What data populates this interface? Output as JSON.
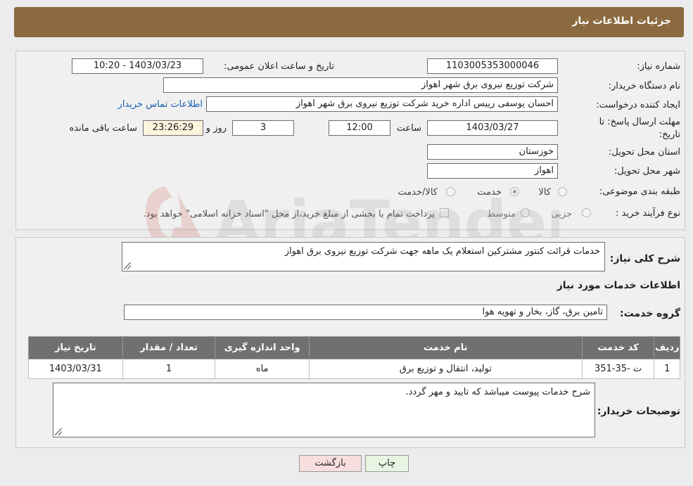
{
  "header": {
    "title": "جزئیات اطلاعات نیاز"
  },
  "form": {
    "need_number_label": "شماره نیاز:",
    "need_number": "1103005353000046",
    "announce_label": "تاریخ و ساعت اعلان عمومی:",
    "announce_value": "1403/03/23 - 10:20",
    "buyer_org_label": "نام دستگاه خریدار:",
    "buyer_org": "شرکت توزیع نیروی برق شهر اهواز",
    "creator_label": "ایجاد کننده درخواست:",
    "creator": "احسان یوسفی رییس اداره خرید شرکت توزیع نیروی برق شهر اهواز",
    "contact_link": "اطلاعات تماس خریدار",
    "deadline_label_1": "مهلت ارسال پاسخ: تا",
    "deadline_label_2": "تاریخ:",
    "deadline_date": "1403/03/27",
    "time_label": "ساعت",
    "deadline_time": "12:00",
    "days_value": "3",
    "days_label": "روز و",
    "remaining_time": "23:26:29",
    "remaining_label": "ساعت باقی مانده",
    "province_label": "استان محل تحویل:",
    "province": "خوزستان",
    "city_label": "شهر محل تحویل:",
    "city": "اهواز",
    "category_label": "طبقه بندی موضوعی:",
    "category_options": [
      "کالا",
      "خدمت",
      "کالا/خدمت"
    ],
    "category_selected": "خدمت",
    "process_label": "نوع فرآیند خرید :",
    "process_options": [
      "جزیی",
      "متوسط"
    ],
    "payment_note": "پرداخت تمام یا بخشی از مبلغ خرید،از محل \"اسناد خزانه اسلامی\" خواهد بود."
  },
  "details": {
    "summary_label": "شرح کلی نیاز:",
    "summary": "خدمات قرائت کنتور مشترکین استعلام یک ماهه جهت شرکت توزیع نیروی برق اهواز",
    "services_title": "اطلاعات خدمات مورد نیاز",
    "service_group_label": "گروه خدمت:",
    "service_group": "تامین برق، گاز، بخار و تهویه هوا"
  },
  "table": {
    "headers": [
      "ردیف",
      "کد خدمت",
      "نام خدمت",
      "واحد اندازه گیری",
      "تعداد / مقدار",
      "تاریخ نیاز"
    ],
    "rows": [
      [
        "1",
        "ت -35-351",
        "تولید، انتقال و توزیع برق",
        "ماه",
        "1",
        "1403/03/31"
      ]
    ]
  },
  "buyer_notes": {
    "label": "توضیحات خریدار:",
    "text": "شرح خدمات پیوست میباشد که تایید و مهر گردد."
  },
  "buttons": {
    "print": "چاپ",
    "back": "بازگشت"
  },
  "watermark": {
    "text": "AriaTender.neT"
  },
  "colors": {
    "header": "#8b6a3f",
    "back_button": "#f8dede",
    "print_button": "#e6f6e2",
    "table_header": "#707070"
  }
}
